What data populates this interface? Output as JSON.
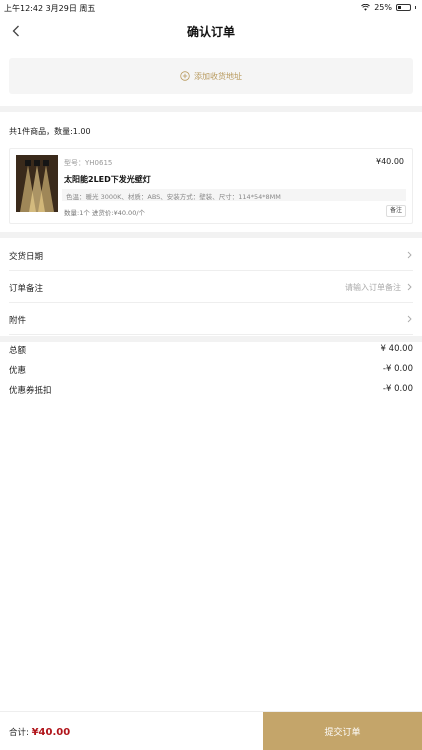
{
  "status_bar": {
    "time_date": "上午12:42   3月29日 周五",
    "battery": "25%",
    "battery_level": 0.25
  },
  "nav": {
    "title": "确认订单"
  },
  "address": {
    "add_label": "添加收货地址"
  },
  "items": {
    "summary": "共1件商品，数量:1.00",
    "product": {
      "model": "型号：YH0615",
      "price": "¥40.00",
      "name": "太阳能2LED下发光壁灯",
      "spec": "色温：暖光 3000K、材质：ABS、安装方式：壁装、尺寸：114*54*8MM",
      "qty_line": "数量:1个  进货价:¥40.00/个",
      "remark_label": "备注"
    }
  },
  "rows": {
    "delivery_date": "交货日期",
    "order_note": "订单备注",
    "order_note_placeholder": "请输入订单备注",
    "attachment": "附件"
  },
  "totals": {
    "total_label": "总额",
    "total_value": "¥ 40.00",
    "discount_label": "优惠",
    "discount_value": "-¥ 0.00",
    "coupon_label": "优惠券抵扣",
    "coupon_value": "-¥ 0.00"
  },
  "bottom": {
    "sum_label": "合计: ",
    "sum_amount": "¥40.00",
    "submit_label": "提交订单"
  },
  "colors": {
    "accent_gold": "#c4a56a",
    "price_red": "#b0141a"
  }
}
